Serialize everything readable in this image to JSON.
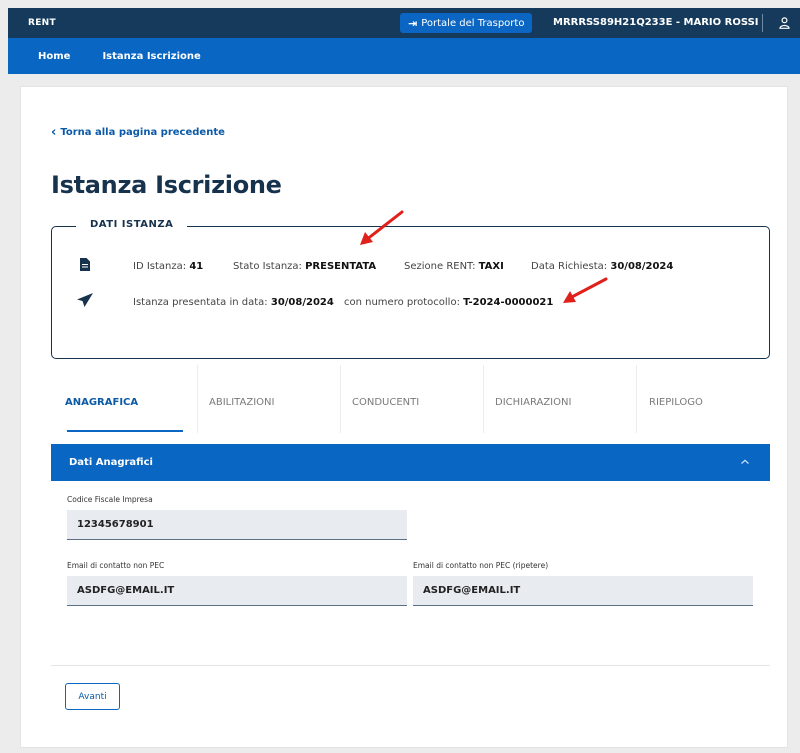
{
  "topbar": {
    "brand": "RENT",
    "portal_button": "Portale del Trasporto",
    "user": "MRRRSS89H21Q233E - MARIO ROSSI"
  },
  "nav": {
    "home": "Home",
    "istanza": "Istanza Iscrizione"
  },
  "back_link": "Torna alla pagina precedente",
  "page_title": "Istanza Iscrizione",
  "dati_istanza": {
    "legend": "DATI ISTANZA",
    "id_label": "ID Istanza:",
    "id_value": "41",
    "stato_label": "Stato Istanza:",
    "stato_value": "PRESENTATA",
    "sezione_label": "Sezione RENT:",
    "sezione_value": "TAXI",
    "data_label": "Data Richiesta:",
    "data_value": "30/08/2024",
    "presentata_label": "Istanza presentata in data:",
    "presentata_value": "30/08/2024",
    "protocollo_label": "con numero protocollo:",
    "protocollo_value": "T-2024-0000021"
  },
  "tabs": [
    "ANAGRAFICA",
    "ABILITAZIONI",
    "CONDUCENTI",
    "DICHIARAZIONI",
    "RIEPILOGO"
  ],
  "accordion": {
    "title": "Dati Anagrafici"
  },
  "fields": {
    "codice_fiscale_label": "Codice Fiscale Impresa",
    "codice_fiscale_value": "12345678901",
    "email_label": "Email di contatto non PEC",
    "email_value": "ASDFG@EMAIL.IT",
    "email_repeat_label": "Email di contatto non PEC (ripetere)",
    "email_repeat_value": "ASDFG@EMAIL.IT"
  },
  "buttons": {
    "avanti": "Avanti"
  },
  "colors": {
    "topbar": "#163a5c",
    "primary": "#0966c2",
    "title": "#17324d",
    "annotation_arrow": "#e0201b"
  },
  "icons": [
    "sign-in-icon",
    "user-icon",
    "chevron-left-icon",
    "document-icon",
    "paper-plane-icon",
    "chevron-up-icon",
    "red-arrow-annotation"
  ]
}
